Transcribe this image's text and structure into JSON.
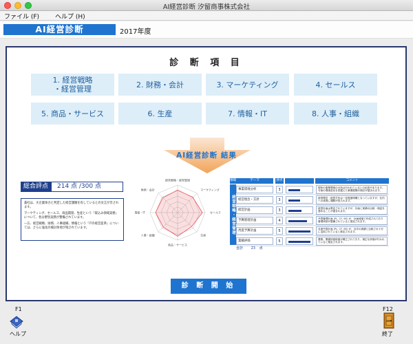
{
  "window": {
    "title": "AI経営診断 汐留商事株式会社"
  },
  "menu": {
    "items": [
      "ファイル (F)",
      "ヘルプ (H)"
    ]
  },
  "header": {
    "badge": "AI経営診断",
    "fiscal_year": "2017年度"
  },
  "section_title": "診 断 項 目",
  "categories": [
    {
      "label": "1. 経営戦略\n・経営管理"
    },
    {
      "label": "2. 財務・会計"
    },
    {
      "label": "3. マーケティング"
    },
    {
      "label": "4. セールス"
    },
    {
      "label": "5. 商品・サービス"
    },
    {
      "label": "6. 生産"
    },
    {
      "label": "7. 情報・IT"
    },
    {
      "label": "8. 人事・組織"
    }
  ],
  "results": {
    "label": "AI経営診断 結果",
    "score_label": "総合評点",
    "score_value": "214 点 /300 点",
    "summary": [
      "貴社は、大企業体力と判定した経営課題を有しているとの文言が示されます。",
      "マーケティング、セールス、商品開発、生産という『取込み領域実務』について、各分野別実務が整備されています。",
      "一方、経営戦略、財務、人事組織、情報という『ITの経営変革』については、さらに強化の検討余地が残されています。"
    ]
  },
  "radar": {
    "axes": [
      "経営戦略・経営管理",
      "マーケティング",
      "セールス",
      "生産",
      "商品・サービス",
      "人事・組織",
      "情報・IT",
      "財務・会計"
    ],
    "values": [
      0.82,
      0.78,
      0.9,
      0.72,
      0.86,
      0.74,
      0.8,
      0.76
    ],
    "color": "#e6505a"
  },
  "table": {
    "headers": [
      "領域",
      "テーマ",
      "評点",
      "",
      "コメント"
    ],
    "side_label": "経営戦略・経営管理",
    "rows": [
      {
        "theme": "事業環境分析",
        "score": "3",
        "bar": 0.5,
        "comment": "現状の事業環境の分析は行われているとの記述があります。今後の環境変化を見据えた事業展開の検討が望まれます。"
      },
      {
        "theme": "経営理念・方針",
        "score": "3",
        "bar": 0.5,
        "comment": "経営理念・経営方針は一定程度明確となっていますが、社内への浸透に課題が見られます。"
      },
      {
        "theme": "経営計画",
        "score": "3",
        "bar": 0.55,
        "comment": "経営計画は策定されていますが、計画と実績の比較・検証を進めることが望まれます。"
      },
      {
        "theme": "予算管理計画",
        "score": "4",
        "bar": 0.8,
        "comment": "予算管理計画 (PL, CF, BS) が、計画段階で作成されており管理体制が整備されていると推定されます。"
      },
      {
        "theme": "月度予算計画",
        "score": "5",
        "bar": 0.95,
        "comment": "月度予算計画 (PL, CF, BS) が、月次の実績と比較され十分に活用されていると推定されます。"
      },
      {
        "theme": "業績評価",
        "score": "5",
        "bar": 0.95,
        "comment": "業務、業績評価制度が確立されており、適正な評価が行われていると推定されます。"
      }
    ],
    "total_label": "合計",
    "total_value": "23",
    "total_unit": "点"
  },
  "start_button": "診 断 開 始",
  "footer": {
    "help_key": "F1",
    "help_label": "ヘルプ",
    "exit_key": "F12",
    "exit_label": "終了"
  }
}
